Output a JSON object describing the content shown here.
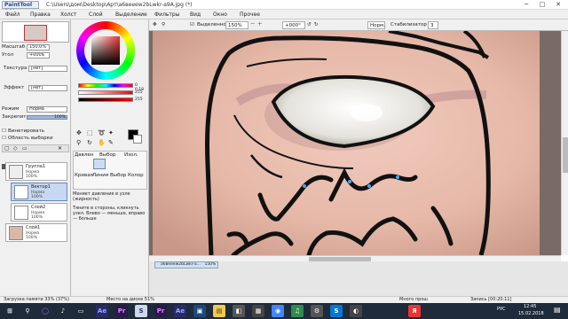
{
  "app": {
    "logo": "PaintTool SAI",
    "title": "C:\\Users\\дом\\Desktop\\Арт\\a6вееew2bLwkr-a9A.jpg (*)",
    "min": "─",
    "max": "□",
    "close": "✕"
  },
  "menu": [
    "Файл",
    "Правка",
    "Холст",
    "Слой",
    "Выделение",
    "Фильтры",
    "Вид",
    "Окно",
    "Прочее"
  ],
  "toolbar": {
    "selected_label": "Выделенное",
    "zoom": "150%",
    "rotation": "+000°",
    "mode": "Норм.",
    "stab_label": "Стабилизатор",
    "stab_value": "3"
  },
  "nav": {
    "zoom_label": "Масштаб",
    "zoom_value": "150.0%",
    "angle_label": "Угол",
    "angle_value": "+000$"
  },
  "props": {
    "texture_label": "Текстура",
    "texture_value": "[нет]",
    "effect_label": "Эффект",
    "effect_value": "[нет]",
    "mode_label": "Режим",
    "mode_value": "Норма",
    "opacity_label": "Закрепить",
    "opacity_value": "100%",
    "check1": "Винетировать",
    "check2": "Область выборки"
  },
  "layers": [
    {
      "name": "Группа1",
      "mode": "Норма",
      "pct": "100%"
    },
    {
      "name": "Вектор1",
      "mode": "Норма",
      "pct": "100%"
    },
    {
      "name": "Слой2",
      "mode": "Норма",
      "pct": "100%"
    },
    {
      "name": "Слой1",
      "mode": "Норма",
      "pct": "100%"
    }
  ],
  "sliders": {
    "h": "0 0.18",
    "s": "255",
    "v": "255"
  },
  "tools": {
    "tab1": "Кривая",
    "tab2": "Линия",
    "tab3": "Выбор",
    "tab4": "Колор",
    "sub1": "Давлен",
    "sub2": "Выбор",
    "sub3": "Изол."
  },
  "help": {
    "line1": "Меняет давление в узле (жирность)",
    "line2": "Тяните в стороны, кликнуть узел. Влево — меньше, вправо — больше"
  },
  "doctab": {
    "name": "a6вееew2bLwkr-a...",
    "zoom": "150%"
  },
  "status": {
    "memory": "Загрузка памяти 33% (37%)",
    "drive": "Место на диске 51%",
    "right": "Запись [00:20:11]"
  },
  "taskbar": {
    "lang": "РУС",
    "time": "12:45",
    "date": "15.02.2018",
    "hint": "Много прош"
  },
  "colors": {
    "accent": "#1f2a3a",
    "selected_layer": "#c8d8f0",
    "skin": "#e9c0b4"
  },
  "icons": [
    "windows-icon",
    "search-icon",
    "cortana-icon",
    "mic-icon",
    "task-view-icon",
    "ae-icon",
    "pr-icon",
    "sai-icon",
    "explorer-icon",
    "store-icon",
    "chrome-icon",
    "yandex-icon"
  ]
}
